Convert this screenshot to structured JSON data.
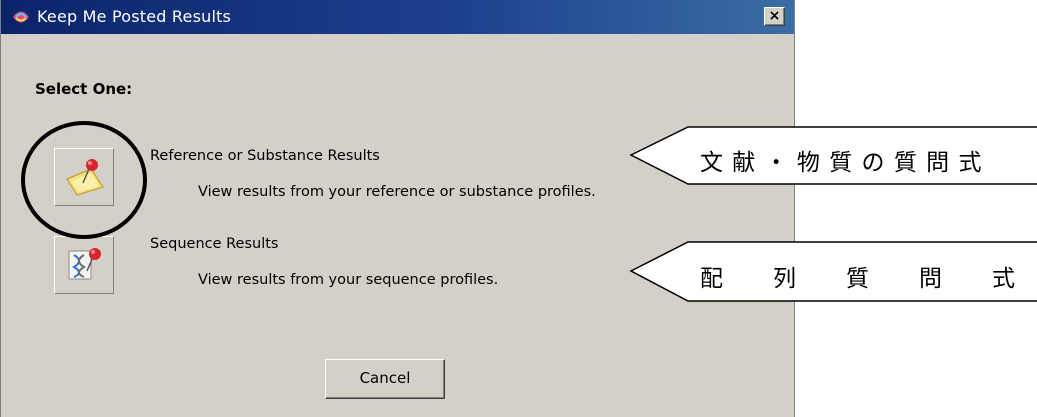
{
  "window": {
    "title": "Keep Me Posted Results",
    "close_label": "×"
  },
  "dialog": {
    "heading": "Select One:",
    "options": [
      {
        "label": "Reference or Substance Results",
        "description": "View results from your reference or substance profiles.",
        "icon": "pushpin-note-icon"
      },
      {
        "label": "Sequence Results",
        "description": "View results from your sequence profiles.",
        "icon": "dna-pushpin-icon"
      }
    ],
    "cancel_label": "Cancel"
  },
  "annotations": {
    "callout_1": "文 献 ・ 物 質 の 質 問 式",
    "callout_2": [
      "配",
      "列",
      "質",
      "問",
      "式"
    ]
  },
  "colors": {
    "titlebar_start": "#0a246a",
    "titlebar_end": "#3a6ea5",
    "dialog_face": "#d4d0c8"
  }
}
